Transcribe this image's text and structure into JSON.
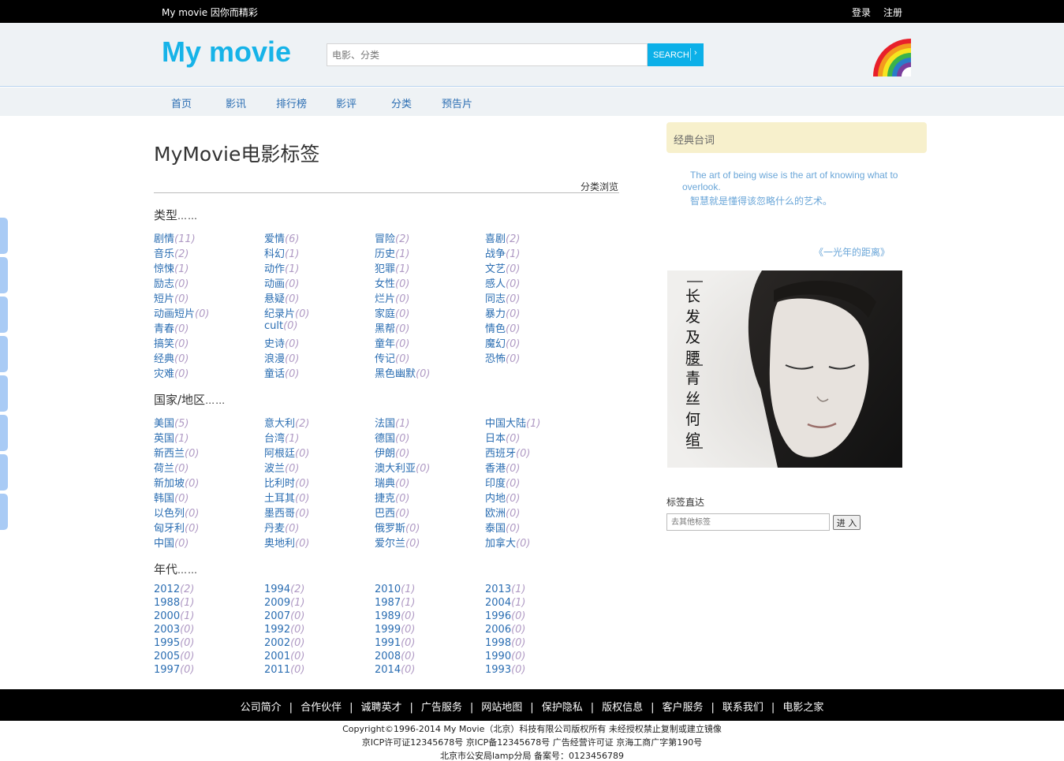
{
  "topbar": {
    "slogan": "My movie 因你而精彩",
    "login": "登录",
    "register": "注册"
  },
  "header": {
    "logo": "My movie",
    "search_placeholder": "电影、分类",
    "search_button": "SEARCH",
    "search_arrow": "›"
  },
  "nav": [
    "首页",
    "影讯",
    "排行榜",
    "影评",
    "分类",
    "预告片"
  ],
  "main": {
    "title": "MyMovie电影标签",
    "browse": "分类浏览",
    "sections": [
      {
        "title": "类型",
        "dots": "……",
        "tags": [
          {
            "name": "剧情",
            "count": "(11)"
          },
          {
            "name": "爱情",
            "count": "(6)"
          },
          {
            "name": "冒险",
            "count": "(2)"
          },
          {
            "name": "喜剧",
            "count": "(2)"
          },
          {
            "name": "音乐",
            "count": "(2)"
          },
          {
            "name": "科幻",
            "count": "(1)"
          },
          {
            "name": "历史",
            "count": "(1)"
          },
          {
            "name": "战争",
            "count": "(1)"
          },
          {
            "name": "惊悚",
            "count": "(1)"
          },
          {
            "name": "动作",
            "count": "(1)"
          },
          {
            "name": "犯罪",
            "count": "(1)"
          },
          {
            "name": "文艺",
            "count": "(0)"
          },
          {
            "name": "励志",
            "count": "(0)"
          },
          {
            "name": "动画",
            "count": "(0)"
          },
          {
            "name": "女性",
            "count": "(0)"
          },
          {
            "name": "感人",
            "count": "(0)"
          },
          {
            "name": "短片",
            "count": "(0)"
          },
          {
            "name": "悬疑",
            "count": "(0)"
          },
          {
            "name": "烂片",
            "count": "(0)"
          },
          {
            "name": "同志",
            "count": "(0)"
          },
          {
            "name": "动画短片",
            "count": "(0)"
          },
          {
            "name": "纪录片",
            "count": "(0)"
          },
          {
            "name": "家庭",
            "count": "(0)"
          },
          {
            "name": "暴力",
            "count": "(0)"
          },
          {
            "name": "青春",
            "count": "(0)"
          },
          {
            "name": "cult",
            "count": "(0)"
          },
          {
            "name": "黑帮",
            "count": "(0)"
          },
          {
            "name": "情色",
            "count": "(0)"
          },
          {
            "name": "搞笑",
            "count": "(0)"
          },
          {
            "name": "史诗",
            "count": "(0)"
          },
          {
            "name": "童年",
            "count": "(0)"
          },
          {
            "name": "魔幻",
            "count": "(0)"
          },
          {
            "name": "经典",
            "count": "(0)"
          },
          {
            "name": "浪漫",
            "count": "(0)"
          },
          {
            "name": "传记",
            "count": "(0)"
          },
          {
            "name": "恐怖",
            "count": "(0)"
          },
          {
            "name": "灾难",
            "count": "(0)"
          },
          {
            "name": "童话",
            "count": "(0)"
          },
          {
            "name": "黑色幽默",
            "count": "(0)"
          }
        ]
      },
      {
        "title": "国家/地区",
        "dots": "……",
        "tags": [
          {
            "name": "美国",
            "count": "(5)"
          },
          {
            "name": "意大利",
            "count": "(2)"
          },
          {
            "name": "法国",
            "count": "(1)"
          },
          {
            "name": "中国大陆",
            "count": "(1)"
          },
          {
            "name": "英国",
            "count": "(1)"
          },
          {
            "name": "台湾",
            "count": "(1)"
          },
          {
            "name": "德国",
            "count": "(0)"
          },
          {
            "name": "日本",
            "count": "(0)"
          },
          {
            "name": "新西兰",
            "count": "(0)"
          },
          {
            "name": "阿根廷",
            "count": "(0)"
          },
          {
            "name": "伊朗",
            "count": "(0)"
          },
          {
            "name": "西班牙",
            "count": "(0)"
          },
          {
            "name": "荷兰",
            "count": "(0)"
          },
          {
            "name": "波兰",
            "count": "(0)"
          },
          {
            "name": "澳大利亚",
            "count": "(0)"
          },
          {
            "name": "香港",
            "count": "(0)"
          },
          {
            "name": "新加坡",
            "count": "(0)"
          },
          {
            "name": "比利时",
            "count": "(0)"
          },
          {
            "name": "瑞典",
            "count": "(0)"
          },
          {
            "name": "印度",
            "count": "(0)"
          },
          {
            "name": "韩国",
            "count": "(0)"
          },
          {
            "name": "土耳其",
            "count": "(0)"
          },
          {
            "name": "捷克",
            "count": "(0)"
          },
          {
            "name": "内地",
            "count": "(0)"
          },
          {
            "name": "以色列",
            "count": "(0)"
          },
          {
            "name": "墨西哥",
            "count": "(0)"
          },
          {
            "name": "巴西",
            "count": "(0)"
          },
          {
            "name": "欧洲",
            "count": "(0)"
          },
          {
            "name": "匈牙利",
            "count": "(0)"
          },
          {
            "name": "丹麦",
            "count": "(0)"
          },
          {
            "name": "俄罗斯",
            "count": "(0)"
          },
          {
            "name": "泰国",
            "count": "(0)"
          },
          {
            "name": "中国",
            "count": "(0)"
          },
          {
            "name": "奥地利",
            "count": "(0)"
          },
          {
            "name": "爱尔兰",
            "count": "(0)"
          },
          {
            "name": "加拿大",
            "count": "(0)"
          }
        ]
      },
      {
        "title": "年代",
        "dots": "……",
        "tags": [
          {
            "name": "2012",
            "count": "(2)"
          },
          {
            "name": "1994",
            "count": "(2)"
          },
          {
            "name": "2010",
            "count": "(1)"
          },
          {
            "name": "2013",
            "count": "(1)"
          },
          {
            "name": "1988",
            "count": "(1)"
          },
          {
            "name": "2009",
            "count": "(1)"
          },
          {
            "name": "1987",
            "count": "(1)"
          },
          {
            "name": "2004",
            "count": "(1)"
          },
          {
            "name": "2000",
            "count": "(1)"
          },
          {
            "name": "2007",
            "count": "(0)"
          },
          {
            "name": "1989",
            "count": "(0)"
          },
          {
            "name": "1996",
            "count": "(0)"
          },
          {
            "name": "2003",
            "count": "(0)"
          },
          {
            "name": "1992",
            "count": "(0)"
          },
          {
            "name": "1999",
            "count": "(0)"
          },
          {
            "name": "2006",
            "count": "(0)"
          },
          {
            "name": "1995",
            "count": "(0)"
          },
          {
            "name": "2002",
            "count": "(0)"
          },
          {
            "name": "1991",
            "count": "(0)"
          },
          {
            "name": "1998",
            "count": "(0)"
          },
          {
            "name": "2005",
            "count": "(0)"
          },
          {
            "name": "2001",
            "count": "(0)"
          },
          {
            "name": "2008",
            "count": "(0)"
          },
          {
            "name": "1990",
            "count": "(0)"
          },
          {
            "name": "1997",
            "count": "(0)"
          },
          {
            "name": "2011",
            "count": "(0)"
          },
          {
            "name": "2014",
            "count": "(0)"
          },
          {
            "name": "1993",
            "count": "(0)"
          }
        ]
      }
    ]
  },
  "sidebar": {
    "quote_title": "经典台词",
    "quote_en": "The art of being wise is the art of knowing what to overlook.",
    "quote_cn": "智慧就是懂得该忽略什么的艺术。",
    "quote_source": "《一光年的距离》",
    "poster_text": "长发及腰 青丝何绾",
    "tag_direct_label": "标签直达",
    "tag_input_placeholder": "去其他标签",
    "tag_go": "进 入"
  },
  "footer": {
    "links": [
      "公司简介",
      "合作伙伴",
      "诚聘英才",
      "广告服务",
      "网站地图",
      "保护隐私",
      "版权信息",
      "客户服务",
      "联系我们",
      "电影之家"
    ],
    "copyright": "Copyright©1996-2014 My Movie（北京）科技有限公司版权所有 未经授权禁止复制或建立镜像",
    "icp": "京ICP许可证12345678号 京ICP备12345678号    广告经营许可证 京海工商广字第190号",
    "police": "北京市公安局lamp分局 备案号：0123456789"
  },
  "colors": {
    "brand": "#16b3e8",
    "link": "#2a6db2",
    "count": "#b09ac4",
    "quote": "#6aa6d8"
  }
}
